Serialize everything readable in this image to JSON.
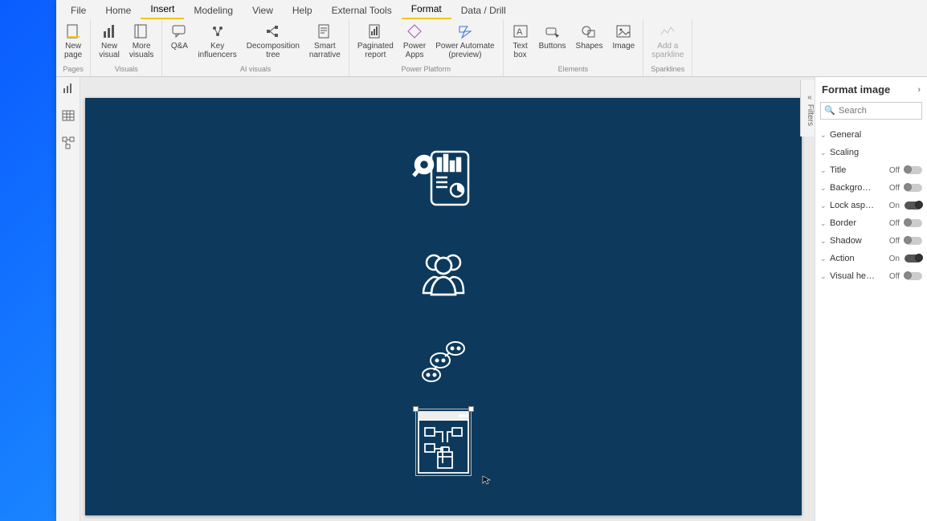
{
  "tabs": {
    "file": "File",
    "home": "Home",
    "insert": "Insert",
    "modeling": "Modeling",
    "view": "View",
    "help": "Help",
    "external": "External Tools",
    "format": "Format",
    "data_drill": "Data / Drill",
    "active": "insert"
  },
  "ribbon": {
    "pages": {
      "label": "Pages",
      "new_page": "New\npage"
    },
    "visuals": {
      "label": "Visuals",
      "new_visual": "New\nvisual",
      "more_visuals": "More\nvisuals"
    },
    "ai": {
      "label": "AI visuals",
      "qa": "Q&A",
      "key_infl": "Key\ninfluencers",
      "decomp": "Decomposition\ntree",
      "smart": "Smart\nnarrative"
    },
    "pp": {
      "label": "Power Platform",
      "paginated": "Paginated\nreport",
      "papps": "Power\nApps",
      "pauto": "Power Automate\n(preview)"
    },
    "elements": {
      "label": "Elements",
      "text_box": "Text\nbox",
      "buttons": "Buttons",
      "shapes": "Shapes",
      "image": "Image"
    },
    "sparklines": {
      "label": "Sparklines",
      "add": "Add a\nsparkline"
    }
  },
  "filters_tab": "Filters",
  "format_pane": {
    "title": "Format image",
    "search_placeholder": "Search",
    "sections": {
      "general": {
        "label": "General"
      },
      "scaling": {
        "label": "Scaling"
      },
      "title": {
        "label": "Title",
        "state": "Off",
        "on": false
      },
      "background": {
        "label": "Backgro…",
        "state": "Off",
        "on": false
      },
      "lock": {
        "label": "Lock asp…",
        "state": "On",
        "on": true
      },
      "border": {
        "label": "Border",
        "state": "Off",
        "on": false
      },
      "shadow": {
        "label": "Shadow",
        "state": "Off",
        "on": false
      },
      "action": {
        "label": "Action",
        "state": "On",
        "on": true
      },
      "header": {
        "label": "Visual he…",
        "state": "Off",
        "on": false
      }
    }
  }
}
